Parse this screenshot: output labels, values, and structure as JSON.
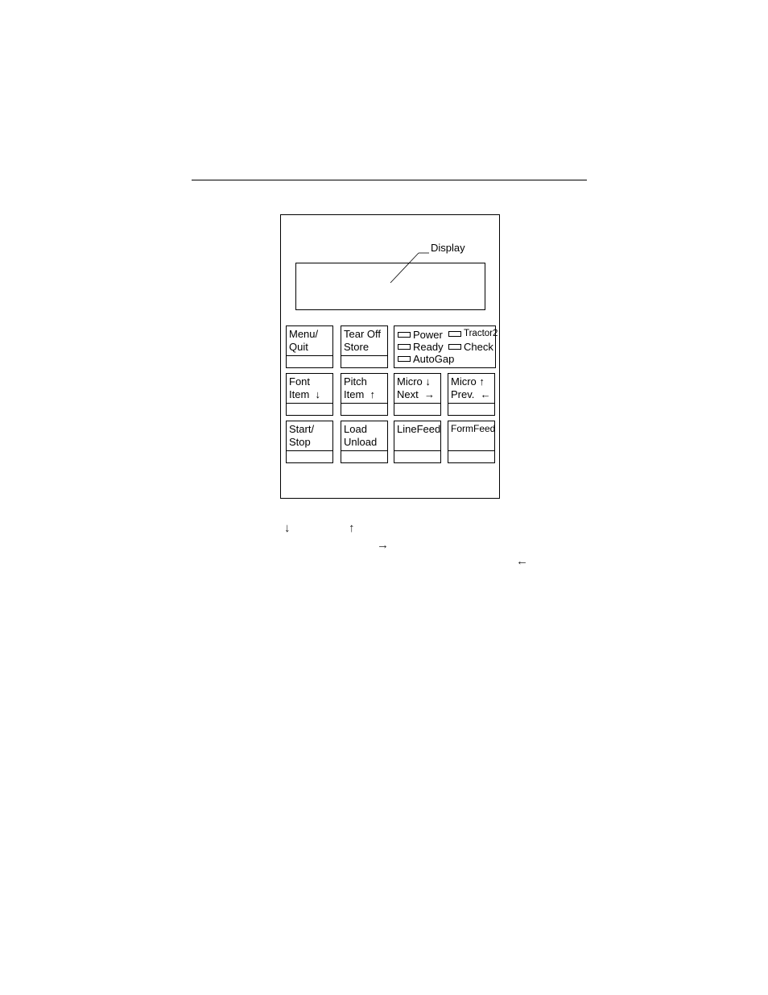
{
  "panel": {
    "display_label": "Display",
    "keys": [
      {
        "id": "menu-quit",
        "label": "Menu/\nQuit"
      },
      {
        "id": "tear-off-store",
        "label": "Tear Off\nStore"
      },
      {
        "id": "font-item",
        "label": "Font\nItem  ↓"
      },
      {
        "id": "pitch-item",
        "label": "Pitch\nItem  ↑"
      },
      {
        "id": "micro-next",
        "label": "Micro ↓\nNext  →"
      },
      {
        "id": "micro-prev",
        "label": "Micro ↑\nPrev.  ←"
      },
      {
        "id": "start-stop",
        "label": "Start/\nStop"
      },
      {
        "id": "load-unload",
        "label": "Load\nUnload"
      },
      {
        "id": "linefeed",
        "label": "LineFeed"
      },
      {
        "id": "formfeed",
        "label": "FormFeed"
      }
    ],
    "indicators": {
      "power": "Power",
      "tractor2": "Tractor2",
      "ready": "Ready",
      "check": "Check",
      "autogap": "AutoGap"
    }
  },
  "footnote_arrows": {
    "down": "↓",
    "up": "↑",
    "right": "→",
    "left": "←"
  }
}
